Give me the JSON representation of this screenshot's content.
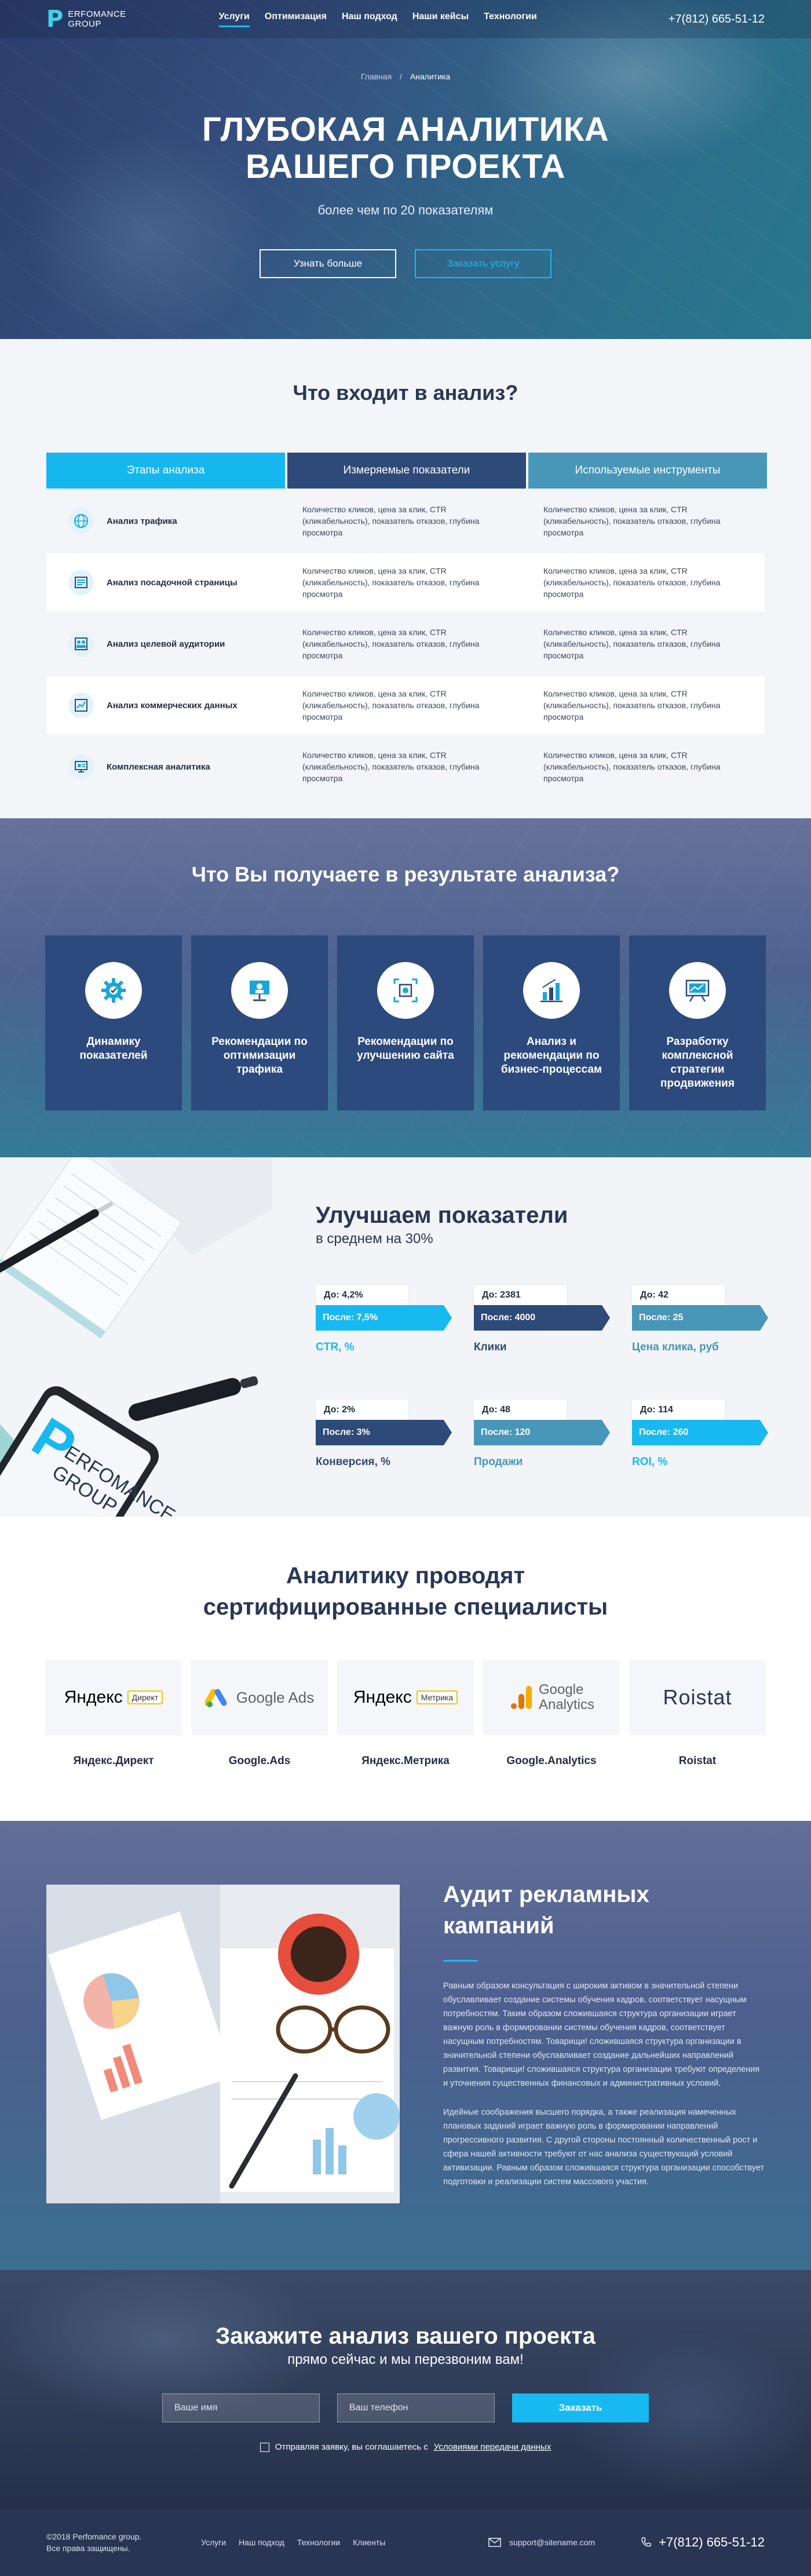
{
  "header": {
    "logo_mark": "P",
    "logo_line1": "ERFOMANCE",
    "logo_line2": "GROUP",
    "nav": [
      "Услуги",
      "Оптимизация",
      "Наш подход",
      "Наши кейсы",
      "Технологии"
    ],
    "phone": "+7(812) 665-51-12"
  },
  "hero": {
    "breadcrumb_home": "Главная",
    "breadcrumb_sep": "/",
    "breadcrumb_current": "Аналитика",
    "title_line1": "ГЛУБОКАЯ АНАЛИТИКА",
    "title_line2": "ВАШЕГО ПРОЕКТА",
    "subtitle": "более чем по 20 показателям",
    "btn_more": "Узнать больше",
    "btn_order": "Заказать услугу"
  },
  "analysis": {
    "title": "Что входит в анализ?",
    "headers": [
      "Этапы анализа",
      "Измеряемые показатели",
      "Используемые инструменты"
    ],
    "rows": [
      {
        "icon": "globe-icon",
        "stage": "Анализ трафика",
        "metrics": "Количество кликов, цена за клик, CTR (кликабельность), показатель отказов, глубина просмотра",
        "tools": "Количество кликов, цена за клик, CTR (кликабельность), показатель отказов, глубина просмотра"
      },
      {
        "icon": "page-icon",
        "stage": "Анализ посадочной страницы",
        "metrics": "Количество кликов, цена за клик, CTR (кликабельность), показатель отказов, глубина просмотра",
        "tools": "Количество кликов, цена за клик, CTR (кликабельность), показатель отказов, глубина просмотра"
      },
      {
        "icon": "audience-icon",
        "stage": "Анализ целевой аудитории",
        "metrics": "Количество кликов, цена за клик, CTR (кликабельность), показатель отказов, глубина просмотра",
        "tools": "Количество кликов, цена за клик, CTR (кликабельность), показатель отказов, глубина просмотра"
      },
      {
        "icon": "chart-icon",
        "stage": "Анализ коммерческих данных",
        "metrics": "Количество кликов, цена за клик, CTR (кликабельность), показатель отказов, глубина просмотра",
        "tools": "Количество кликов, цена за клик, CTR (кликабельность), показатель отказов, глубина просмотра"
      },
      {
        "icon": "monitor-icon",
        "stage": "Комплексная аналитика",
        "metrics": "Количество кликов, цена за клик, CTR (кликабельность), показатель отказов, глубина просмотра",
        "tools": "Количество кликов, цена за клик, CTR (кликабельность), показатель отказов, глубина просмотра"
      }
    ]
  },
  "results": {
    "title": "Что Вы получаете в результате анализа?",
    "cards": [
      {
        "icon": "gear-icon",
        "label": "Динамику показателей"
      },
      {
        "icon": "presentation-icon",
        "label": "Рекомендации по оптимизации трафика"
      },
      {
        "icon": "expand-icon",
        "label": "Рекомендации по улучшению сайта"
      },
      {
        "icon": "bar-chart-icon",
        "label": "Анализ и рекомендации по бизнес-процессам"
      },
      {
        "icon": "board-icon",
        "label": "Разработку комплексной стратегии продвижения"
      }
    ]
  },
  "improve": {
    "title": "Улучшаем показатели",
    "subtitle": "в среднем на 30%",
    "desk_logo_mark": "P",
    "desk_logo_line1": "ERFOMANCE",
    "desk_logo_line2": "GROUP",
    "metrics": [
      {
        "before": "До: 4,2%",
        "after": "После: 7,5%",
        "label": "CTR, %",
        "color": "#18b9f0",
        "label_color": "#18b9f0"
      },
      {
        "before": "До: 2381",
        "after": "После: 4000",
        "label": "Клики",
        "color": "#2e4a78",
        "label_color": "#2e4a78"
      },
      {
        "before": "До: 42",
        "after": "После: 25",
        "label": "Цена клика, руб",
        "color": "#4897b8",
        "label_color": "#4897b8"
      },
      {
        "before": "До: 2%",
        "after": "После: 3%",
        "label": "Конверсия, %",
        "color": "#2e4a78",
        "label_color": "#2e4a78"
      },
      {
        "before": "До: 48",
        "after": "После: 120",
        "label": "Продажи",
        "color": "#4897b8",
        "label_color": "#4897b8"
      },
      {
        "before": "До: 114",
        "after": "После: 260",
        "label": "ROI, %",
        "color": "#18b9f0",
        "label_color": "#18b9f0"
      }
    ]
  },
  "specialists": {
    "title_line1": "Аналитику проводят",
    "title_line2": "сертифицированные специалисты",
    "logos": [
      {
        "name": "Яндекс.Директ",
        "logo_a": "Яндекс",
        "logo_b": "Директ"
      },
      {
        "name": "Google.Ads",
        "logo_a": "Google Ads",
        "logo_b": ""
      },
      {
        "name": "Яндекс.Метрика",
        "logo_a": "Яндекс",
        "logo_b": "Метрика"
      },
      {
        "name": "Google.Analytics",
        "logo_a": "Google",
        "logo_b": "Analytics"
      },
      {
        "name": "Roistat",
        "logo_a": "Roistat",
        "logo_b": ""
      }
    ]
  },
  "audit": {
    "title_line1": "Аудит рекламных",
    "title_line2": "кампаний",
    "p1": "Равным образом консультация с широким активом в значительной степени обуславливает создание системы обучения кадров, соответствует насущным потребностям. Таким образом сложившаяся структура организации играет важную роль в формировании системы обучения кадров, соответствует насущным потребностям. Товарищи! сложившаяся структура организации в значительной степени обуславливает создание дальнейших направлений развития. Товарищи! сложившаяся структура организации требуют определения и уточнения существенных финансовых и административных условий.",
    "p2": "Идейные соображения высшего порядка, а также реализация намеченных плановых заданий играет важную роль в формировании направлений прогрессивного развития. С другой стороны постоянный количественный рост и сфера нашей активности требуют от нас анализа существующий условий активизации. Равным образом сложившаяся структура организации способствует подготовки и реализации систем массового участия."
  },
  "order": {
    "title": "Закажите анализ вашего проекта",
    "subtitle": "прямо сейчас и мы перезвоним вам!",
    "name_placeholder": "Ваше имя",
    "phone_placeholder": "Ваш телефон",
    "submit": "Заказать",
    "agree_text": "Отправляя заявку, вы соглашаетесь с",
    "agree_link": "Условиями передачи данных"
  },
  "footer": {
    "copy1": "©2018 Perfomance group.",
    "copy2": "Все права защищены.",
    "nav": [
      "Услуги",
      "Наш подход",
      "Технологии",
      "Клиенты"
    ],
    "email": "support@sitename.com",
    "phone": "+7(812) 665-51-12"
  },
  "colors": {
    "accent": "#18b9f0",
    "navy": "#2e4a78",
    "teal": "#4897b8"
  }
}
